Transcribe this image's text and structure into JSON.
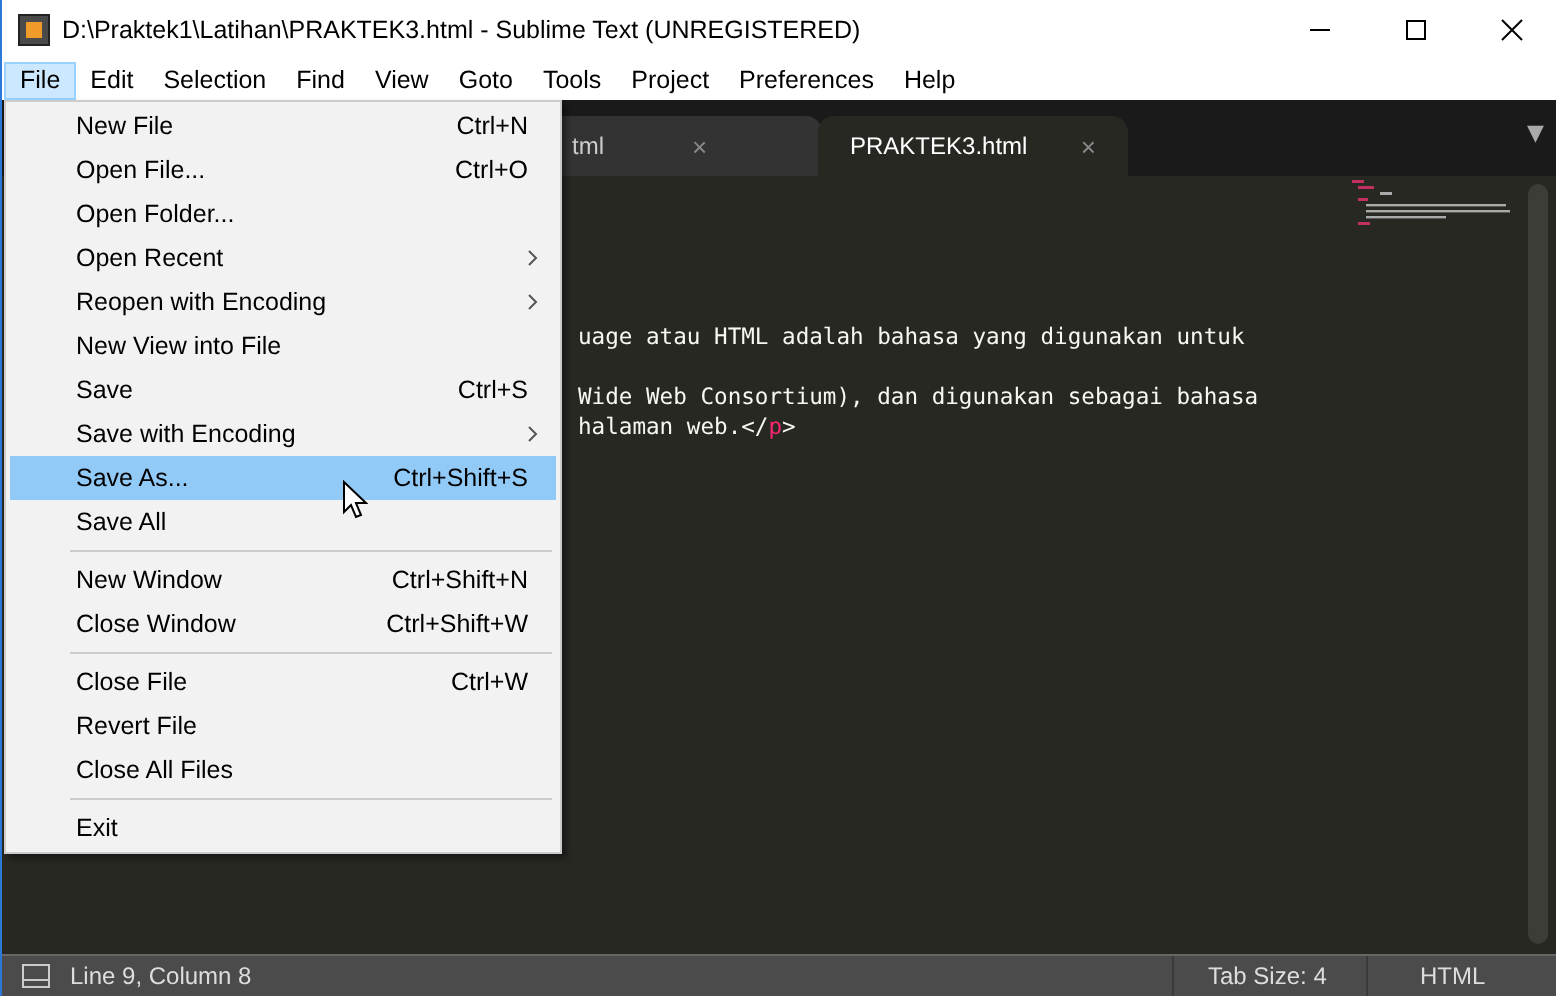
{
  "window": {
    "title": "D:\\Praktek1\\Latihan\\PRAKTEK3.html - Sublime Text (UNREGISTERED)"
  },
  "menubar": [
    {
      "label": "File",
      "selected": true
    },
    {
      "label": "Edit",
      "selected": false
    },
    {
      "label": "Selection",
      "selected": false
    },
    {
      "label": "Find",
      "selected": false
    },
    {
      "label": "View",
      "selected": false
    },
    {
      "label": "Goto",
      "selected": false
    },
    {
      "label": "Tools",
      "selected": false
    },
    {
      "label": "Project",
      "selected": false
    },
    {
      "label": "Preferences",
      "selected": false
    },
    {
      "label": "Help",
      "selected": false
    }
  ],
  "tabs": [
    {
      "label": "tml",
      "close": "×",
      "selected": false
    },
    {
      "label": "PRAKTEK3.html",
      "close": "×",
      "selected": true
    }
  ],
  "tab_menu": "▼",
  "code_lines": [
    {
      "parts": [
        {
          "kind": "text",
          "text": "uage atau HTML adalah bahasa yang digunakan untuk"
        }
      ]
    },
    {
      "parts": [
        {
          "kind": "text",
          "text": "Wide Web Consortium), dan digunakan sebagai bahasa"
        }
      ]
    },
    {
      "parts": [
        {
          "kind": "text",
          "text": "halaman web.</"
        },
        {
          "kind": "tag",
          "text": "p"
        },
        {
          "kind": "text",
          "text": ">"
        }
      ]
    }
  ],
  "file_menu": [
    {
      "kind": "item",
      "label": "New File",
      "shortcut": "Ctrl+N",
      "submenu": false,
      "selected": false
    },
    {
      "kind": "item",
      "label": "Open File...",
      "shortcut": "Ctrl+O",
      "submenu": false,
      "selected": false
    },
    {
      "kind": "item",
      "label": "Open Folder...",
      "submenu": false,
      "selected": false
    },
    {
      "kind": "item",
      "label": "Open Recent",
      "submenu": true,
      "selected": false
    },
    {
      "kind": "item",
      "label": "Reopen with Encoding",
      "submenu": true,
      "selected": false
    },
    {
      "kind": "item",
      "label": "New View into File",
      "submenu": false,
      "selected": false
    },
    {
      "kind": "item",
      "label": "Save",
      "shortcut": "Ctrl+S",
      "submenu": false,
      "selected": false
    },
    {
      "kind": "item",
      "label": "Save with Encoding",
      "submenu": true,
      "selected": false
    },
    {
      "kind": "item",
      "label": "Save As...",
      "shortcut": "Ctrl+Shift+S",
      "submenu": false,
      "selected": true
    },
    {
      "kind": "item",
      "label": "Save All",
      "submenu": false,
      "selected": false
    },
    {
      "kind": "separator"
    },
    {
      "kind": "item",
      "label": "New Window",
      "shortcut": "Ctrl+Shift+N",
      "submenu": false,
      "selected": false
    },
    {
      "kind": "item",
      "label": "Close Window",
      "shortcut": "Ctrl+Shift+W",
      "submenu": false,
      "selected": false
    },
    {
      "kind": "separator"
    },
    {
      "kind": "item",
      "label": "Close File",
      "shortcut": "Ctrl+W",
      "submenu": false,
      "selected": false
    },
    {
      "kind": "item",
      "label": "Revert File",
      "submenu": false,
      "selected": false
    },
    {
      "kind": "item",
      "label": "Close All Files",
      "submenu": false,
      "selected": false
    },
    {
      "kind": "separator"
    },
    {
      "kind": "item",
      "label": "Exit",
      "submenu": false,
      "selected": false
    }
  ],
  "status_bar": {
    "position": "Line 9, Column 8",
    "tab_size": "Tab Size: 4",
    "syntax": "HTML"
  }
}
